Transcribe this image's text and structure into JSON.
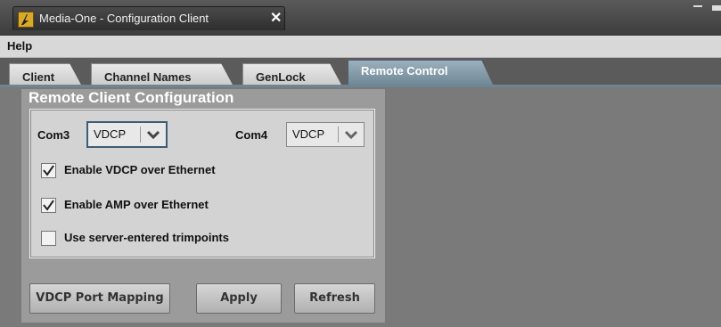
{
  "window": {
    "tab_title": "Media-One - Configuration Client",
    "close_glyph": "✕"
  },
  "menu": {
    "help": "Help"
  },
  "tabs": [
    {
      "label": "Client",
      "active": false
    },
    {
      "label": "Channel Names",
      "active": false
    },
    {
      "label": "GenLock",
      "active": false
    },
    {
      "label": "Remote Control",
      "active": true
    }
  ],
  "section": {
    "title": "Remote Client Configuration"
  },
  "com3": {
    "label": "Com3",
    "value": "VDCP"
  },
  "com4": {
    "label": "Com4",
    "value": "VDCP"
  },
  "checkboxes": [
    {
      "label": "Enable VDCP over Ethernet",
      "checked": true
    },
    {
      "label": "Enable AMP over Ethernet",
      "checked": true
    },
    {
      "label": "Use server-entered trimpoints",
      "checked": false
    }
  ],
  "buttons": {
    "port_mapping": "VDCP Port Mapping",
    "apply": "Apply",
    "refresh": "Refresh"
  },
  "colors": {
    "active_tab": "#6e8593",
    "panel": "#d3d3d3",
    "accent_focus": "#3d5d75"
  },
  "icons": {
    "app": "media-one-app-icon",
    "close": "close-icon",
    "dropdown": "chevron-down-icon",
    "check": "checkmark-icon"
  }
}
